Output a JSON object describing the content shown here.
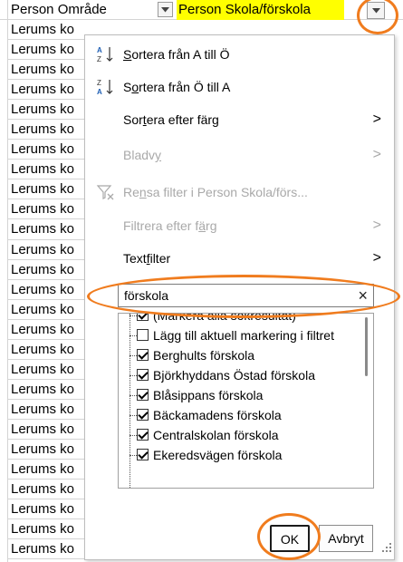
{
  "header": {
    "col_a": "Person Område",
    "col_b": "Person Skola/förskola"
  },
  "rows": [
    "Lerums ko",
    "Lerums ko",
    "Lerums ko",
    "Lerums ko",
    "Lerums ko",
    "Lerums ko",
    "Lerums ko",
    "Lerums ko",
    "Lerums ko",
    "Lerums ko",
    "Lerums ko",
    "Lerums ko",
    "Lerums ko",
    "Lerums ko",
    "Lerums ko",
    "Lerums ko",
    "Lerums ko",
    "Lerums ko",
    "Lerums ko",
    "Lerums ko",
    "Lerums ko",
    "Lerums ko",
    "Lerums ko",
    "Lerums ko",
    "Lerums ko",
    "Lerums ko",
    "Lerums ko"
  ],
  "menu": {
    "sort_az": {
      "pre": "",
      "key": "S",
      "post": "ortera från A till Ö"
    },
    "sort_za": {
      "pre": "S",
      "key": "o",
      "post": "rtera från Ö till A"
    },
    "sort_color": {
      "pre": "Sor",
      "key": "t",
      "post": "era efter färg"
    },
    "sheet_view": {
      "pre": "Bladv",
      "key": "y",
      "post": ""
    },
    "clear_filter": {
      "pre": "Re",
      "key": "n",
      "post": "sa filter i Person Skola/förs..."
    },
    "filter_color": {
      "pre": "Filtrera efter f",
      "key": "ä",
      "post": "rg"
    },
    "text_filter": {
      "pre": "Text",
      "key": "f",
      "post": "ilter"
    }
  },
  "search": {
    "value": "förskola",
    "clear_glyph": "×"
  },
  "list_items": [
    {
      "label": "(Markera alla sökresultat)",
      "checked": true
    },
    {
      "label": "Lägg till aktuell markering i filtret",
      "checked": false
    },
    {
      "label": "Berghults förskola",
      "checked": true
    },
    {
      "label": "Björkhyddans Östad förskola",
      "checked": true
    },
    {
      "label": "Blåsippans förskola",
      "checked": true
    },
    {
      "label": "Bäckamadens förskola",
      "checked": true
    },
    {
      "label": "Centralskolan förskola",
      "checked": true
    },
    {
      "label": "Ekeredsvägen förskola",
      "checked": true
    }
  ],
  "buttons": {
    "ok": "OK",
    "cancel": "Avbryt"
  },
  "arrow_glyph": ">",
  "icons": [
    "sort-az-icon",
    "sort-za-icon",
    "clear-filter-icon",
    "dropdown-arrow-icon",
    "resize-grip-icon"
  ],
  "colors": {
    "highlight": "#ffff00",
    "annotation": "#f07c1e",
    "disabled": "#a9a9a9"
  }
}
